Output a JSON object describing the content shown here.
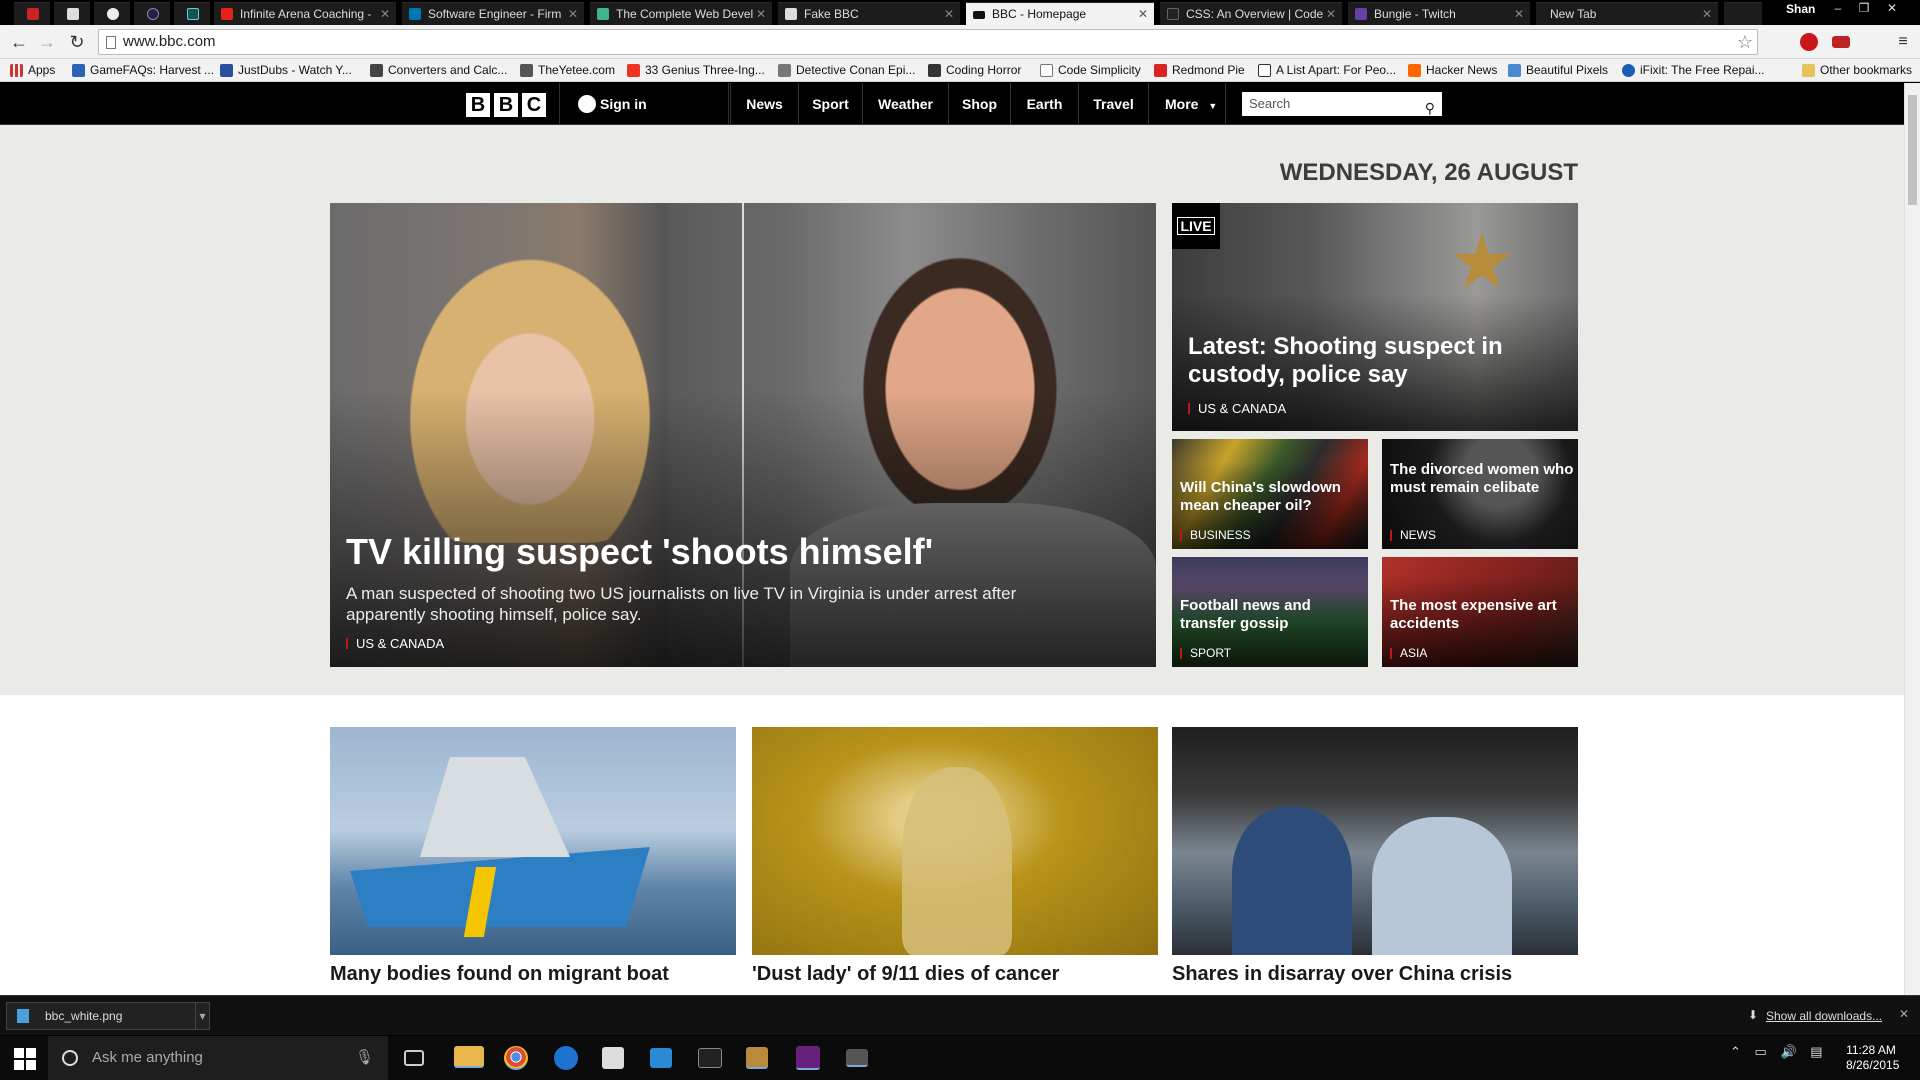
{
  "browser": {
    "tabs": [
      {
        "title": "",
        "type": "pinned"
      },
      {
        "title": "",
        "type": "pinned"
      },
      {
        "title": "",
        "type": "pinned"
      },
      {
        "title": "",
        "type": "pinned"
      },
      {
        "title": "",
        "type": "pinned"
      },
      {
        "title": "Infinite Arena Coaching -"
      },
      {
        "title": "Software Engineer - Firm"
      },
      {
        "title": "The Complete Web Devel"
      },
      {
        "title": "Fake BBC"
      },
      {
        "title": "BBC - Homepage",
        "active": true
      },
      {
        "title": "CSS: An Overview | Code"
      },
      {
        "title": "Bungie - Twitch"
      },
      {
        "title": "New Tab"
      }
    ],
    "profile_name": "Shan",
    "url": "www.bbc.com",
    "bookmarks": [
      "Apps",
      "GameFAQs: Harvest ...",
      "JustDubs - Watch Y...",
      "Converters and Calc...",
      "TheYetee.com",
      "33 Genius Three-Ing...",
      "Detective Conan Epi...",
      "Coding Horror",
      "Code Simplicity",
      "Redmond Pie",
      "A List Apart: For Peo...",
      "Hacker News",
      "Beautiful Pixels",
      "iFixit: The Free Repai..."
    ],
    "other_bookmarks": "Other bookmarks"
  },
  "bbc_nav": {
    "logo": [
      "B",
      "B",
      "C"
    ],
    "signin": "Sign in",
    "items": [
      "News",
      "Sport",
      "Weather",
      "Shop",
      "Earth",
      "Travel",
      "More"
    ],
    "search_placeholder": "Search"
  },
  "hero": {
    "date": "WEDNESDAY, 26 AUGUST",
    "main": {
      "title": "TV killing suspect 'shoots himself'",
      "summary": "A man suspected of shooting two US journalists on live TV in Virginia is under arrest after apparently shooting himself, police say.",
      "tag": "US & CANADA"
    },
    "side_top": {
      "badge": "LIVE",
      "title": "Latest: Shooting suspect in custody, police say",
      "tag": "US & CANADA"
    },
    "tiles": [
      {
        "title": "Will China's slowdown mean cheaper oil?",
        "tag": "BUSINESS"
      },
      {
        "title": "The divorced women who must remain celibate",
        "tag": "NEWS"
      },
      {
        "title": "Football news and transfer gossip",
        "tag": "SPORT"
      },
      {
        "title": "The most expensive art accidents",
        "tag": "ASIA"
      }
    ]
  },
  "stories": [
    {
      "title": "Many bodies found on migrant boat",
      "image": "coast-guard-ship"
    },
    {
      "title": "'Dust lady' of 9/11 dies of cancer",
      "image": "dust-covered-woman"
    },
    {
      "title": "Shares in disarray over China crisis",
      "image": "stock-traders"
    }
  ],
  "downloads": {
    "file": "bbc_white.png",
    "show_all": "Show all downloads..."
  },
  "taskbar": {
    "search_placeholder": "Ask me anything",
    "time": "11:28 AM",
    "date": "8/26/2015"
  }
}
